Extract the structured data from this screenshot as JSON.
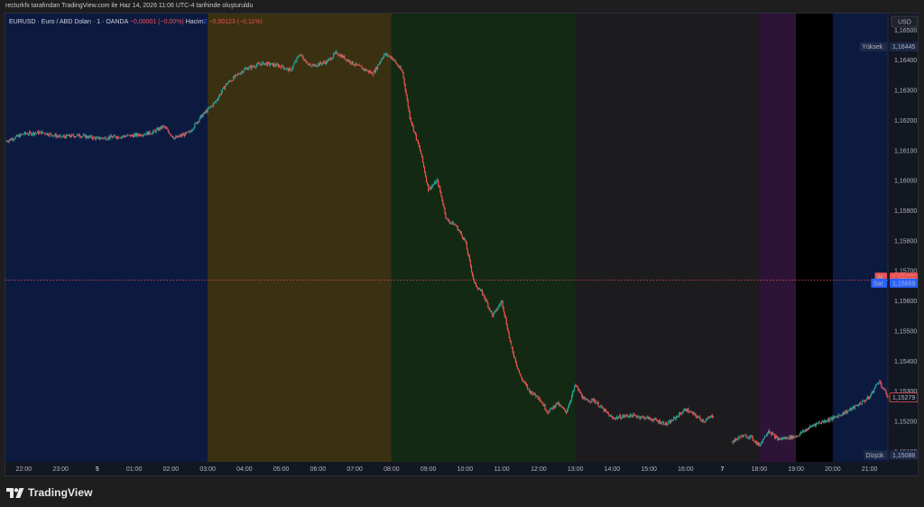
{
  "caption": "recturkfx tarafından TradingView.com ile Haz 14, 2026 11:06 UTC-4 tarihinde oluşturuldu",
  "legend": {
    "symbol": "EURUSD · Euro / ABD Doları · 1 · OANDA",
    "change": "−0,00001 (−0,00%)",
    "volume_label": "Hacim",
    "volume_number": "2",
    "volume_value": "−0,00123 (−0,11%)"
  },
  "currency_button": "USD",
  "brand": {
    "name": "TradingView",
    "logo_icon": "tradingview-logo-icon"
  },
  "colors": {
    "up": "#26a69a",
    "down": "#ef5350",
    "session_asia": "#0d1a40",
    "session_london": "#3a3012",
    "session_newyork": "#132914",
    "session_overlap_close": "#1c1c1f",
    "session_purple": "#2d1437",
    "session_black": "#000000"
  },
  "chart_data": {
    "type": "candlestick",
    "symbol": "EURUSD",
    "interval": "1",
    "ylim": [
      1.15065,
      1.16555
    ],
    "y_ticks": [
      {
        "v": 1.165,
        "label": "1,16500"
      },
      {
        "v": 1.164,
        "label": "1,16400"
      },
      {
        "v": 1.163,
        "label": "1,16300"
      },
      {
        "v": 1.162,
        "label": "1,16200"
      },
      {
        "v": 1.161,
        "label": "1,16100"
      },
      {
        "v": 1.16,
        "label": "1,16000"
      },
      {
        "v": 1.159,
        "label": "1,15900"
      },
      {
        "v": 1.158,
        "label": "1,15800"
      },
      {
        "v": 1.157,
        "label": "1,15700"
      },
      {
        "v": 1.156,
        "label": "1,15600"
      },
      {
        "v": 1.155,
        "label": "1,15500"
      },
      {
        "v": 1.154,
        "label": "1,15400"
      },
      {
        "v": 1.153,
        "label": "1,15300"
      },
      {
        "v": 1.152,
        "label": "1,15200"
      },
      {
        "v": 1.151,
        "label": "1,15100"
      }
    ],
    "x_ticks": [
      {
        "x": 0.5,
        "label": "22:00"
      },
      {
        "x": 1.5,
        "label": "23:00"
      },
      {
        "x": 2.5,
        "label": "5",
        "bold": true
      },
      {
        "x": 3.5,
        "label": "01:00"
      },
      {
        "x": 4.5,
        "label": "02:00"
      },
      {
        "x": 5.5,
        "label": "03:00"
      },
      {
        "x": 6.5,
        "label": "04:00"
      },
      {
        "x": 7.5,
        "label": "05:00"
      },
      {
        "x": 8.5,
        "label": "06:00"
      },
      {
        "x": 9.5,
        "label": "07:00"
      },
      {
        "x": 10.5,
        "label": "08:00"
      },
      {
        "x": 11.5,
        "label": "09:00"
      },
      {
        "x": 12.5,
        "label": "10:00"
      },
      {
        "x": 13.5,
        "label": "11:00"
      },
      {
        "x": 14.5,
        "label": "12:00"
      },
      {
        "x": 15.5,
        "label": "13:00"
      },
      {
        "x": 16.5,
        "label": "14:00"
      },
      {
        "x": 17.5,
        "label": "15:00"
      },
      {
        "x": 18.5,
        "label": "16:00"
      },
      {
        "x": 19.5,
        "label": "7",
        "bold": true
      },
      {
        "x": 20.5,
        "label": "18:00"
      },
      {
        "x": 21.5,
        "label": "19:00"
      },
      {
        "x": 22.5,
        "label": "20:00"
      },
      {
        "x": 23.5,
        "label": "21:00"
      }
    ],
    "xlim": [
      0,
      24
    ],
    "sessions": [
      {
        "from": 0,
        "to": 5.5,
        "color": "#0d1a40"
      },
      {
        "from": 5.5,
        "to": 10.5,
        "color": "#3a3012"
      },
      {
        "from": 10.5,
        "to": 15.5,
        "color": "#132914"
      },
      {
        "from": 15.5,
        "to": 20.5,
        "color": "#1c1c1f"
      },
      {
        "from": 20.5,
        "to": 21.5,
        "color": "#2d1437"
      },
      {
        "from": 21.5,
        "to": 22.5,
        "color": "#000000"
      },
      {
        "from": 22.5,
        "to": 24,
        "color": "#0d1a40"
      }
    ],
    "price_path": [
      [
        0.0,
        1.1613
      ],
      [
        0.5,
        1.16155
      ],
      [
        1.0,
        1.1616
      ],
      [
        1.5,
        1.16145
      ],
      [
        2.0,
        1.1615
      ],
      [
        2.5,
        1.1614
      ],
      [
        3.0,
        1.16145
      ],
      [
        3.5,
        1.1615
      ],
      [
        4.0,
        1.1616
      ],
      [
        4.3,
        1.1618
      ],
      [
        4.6,
        1.1614
      ],
      [
        5.0,
        1.1616
      ],
      [
        5.3,
        1.1621
      ],
      [
        5.7,
        1.1626
      ],
      [
        6.0,
        1.1632
      ],
      [
        6.5,
        1.1637
      ],
      [
        7.0,
        1.1639
      ],
      [
        7.5,
        1.1638
      ],
      [
        7.75,
        1.16365
      ],
      [
        8.0,
        1.1642
      ],
      [
        8.3,
        1.1638
      ],
      [
        8.75,
        1.16395
      ],
      [
        9.0,
        1.16425
      ],
      [
        9.5,
        1.16385
      ],
      [
        10.0,
        1.16355
      ],
      [
        10.3,
        1.1642
      ],
      [
        10.5,
        1.1641
      ],
      [
        10.8,
        1.1636
      ],
      [
        11.0,
        1.1621
      ],
      [
        11.3,
        1.1609
      ],
      [
        11.5,
        1.1597
      ],
      [
        11.75,
        1.16
      ],
      [
        12.0,
        1.1587
      ],
      [
        12.25,
        1.1585
      ],
      [
        12.5,
        1.158
      ],
      [
        12.75,
        1.1566
      ],
      [
        13.0,
        1.1562
      ],
      [
        13.25,
        1.1555
      ],
      [
        13.5,
        1.156
      ],
      [
        13.75,
        1.1545
      ],
      [
        14.0,
        1.1535
      ],
      [
        14.25,
        1.153
      ],
      [
        14.5,
        1.1528
      ],
      [
        14.75,
        1.1523
      ],
      [
        15.0,
        1.1526
      ],
      [
        15.25,
        1.1523
      ],
      [
        15.5,
        1.1532
      ],
      [
        15.75,
        1.1527
      ],
      [
        16.0,
        1.1527
      ],
      [
        16.5,
        1.1521
      ],
      [
        17.0,
        1.1522
      ],
      [
        17.5,
        1.1521
      ],
      [
        18.0,
        1.1519
      ],
      [
        18.5,
        1.1524
      ],
      [
        19.0,
        1.152
      ],
      [
        19.25,
        1.1522
      ],
      [
        19.75,
        1.1513
      ],
      [
        20.0,
        1.1515
      ],
      [
        20.25,
        1.1515
      ],
      [
        20.5,
        1.1512
      ],
      [
        20.75,
        1.1517
      ],
      [
        21.0,
        1.1514
      ],
      [
        21.5,
        1.1515
      ],
      [
        22.0,
        1.1519
      ],
      [
        22.5,
        1.1521
      ],
      [
        23.0,
        1.1524
      ],
      [
        23.5,
        1.1528
      ],
      [
        23.75,
        1.15335
      ],
      [
        24.0,
        1.1528
      ]
    ],
    "gap_after_x": 19.25,
    "high": {
      "label": "Yüksek",
      "value_text": "1,16445",
      "value": 1.16445
    },
    "low": {
      "label": "Düşük",
      "value_text": "1,15088",
      "value": 1.15088
    },
    "bid_ask_line": 1.15669,
    "markers": [
      {
        "label": "Al",
        "value_text": "1,15679",
        "value": 1.15679,
        "color": "#ef5350"
      },
      {
        "label": "",
        "value_text": "1,15669",
        "value": 1.15669,
        "color": "#ef5350"
      },
      {
        "label": "Sat",
        "value_text": "1,15659",
        "value": 1.15659,
        "color": "#2962ff"
      }
    ],
    "last_price": {
      "value_text": "1,15279",
      "value": 1.15279
    }
  }
}
